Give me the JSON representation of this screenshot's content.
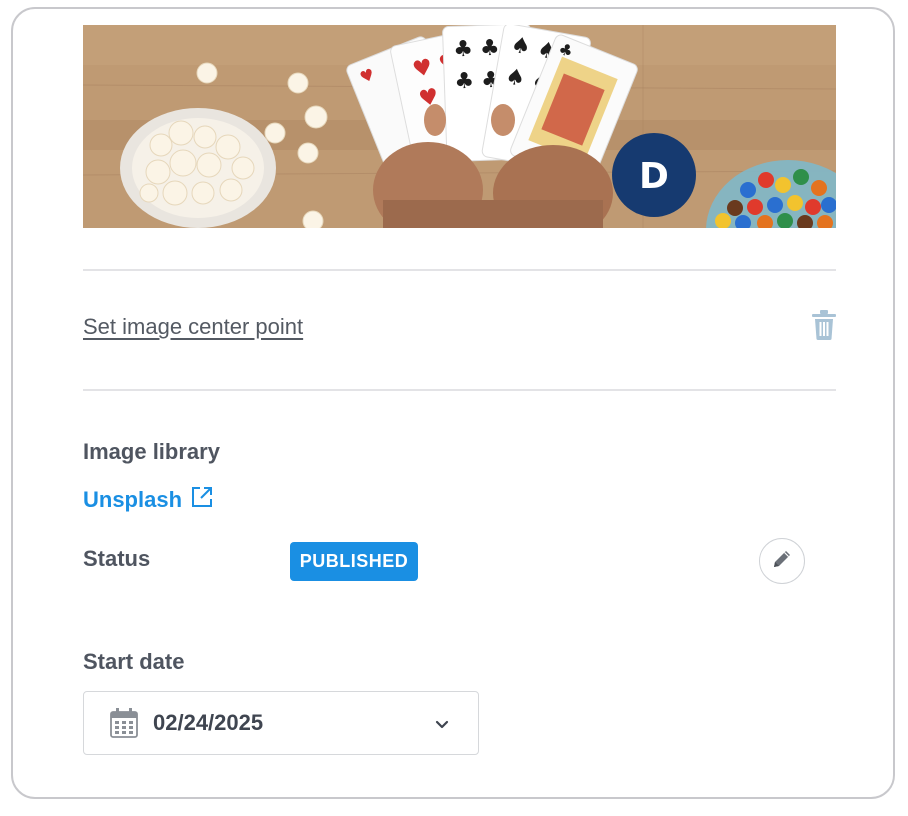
{
  "hero": {
    "avatar_letter": "D",
    "colors": {
      "avatar_bg": "#163a70",
      "wood": "#b8916a"
    }
  },
  "image_actions": {
    "center_point_link": "Set image center point",
    "delete_icon": "trash-icon"
  },
  "library": {
    "label": "Image library",
    "source_link": "Unsplash",
    "source_icon": "external-link-icon"
  },
  "status": {
    "label": "Status",
    "badge": "PUBLISHED",
    "edit_icon": "pencil-icon",
    "colors": {
      "badge_bg": "#1a8fe3"
    }
  },
  "start_date": {
    "label": "Start date",
    "value": "02/24/2025",
    "calendar_icon": "calendar-icon",
    "chevron_icon": "chevron-down-icon"
  }
}
